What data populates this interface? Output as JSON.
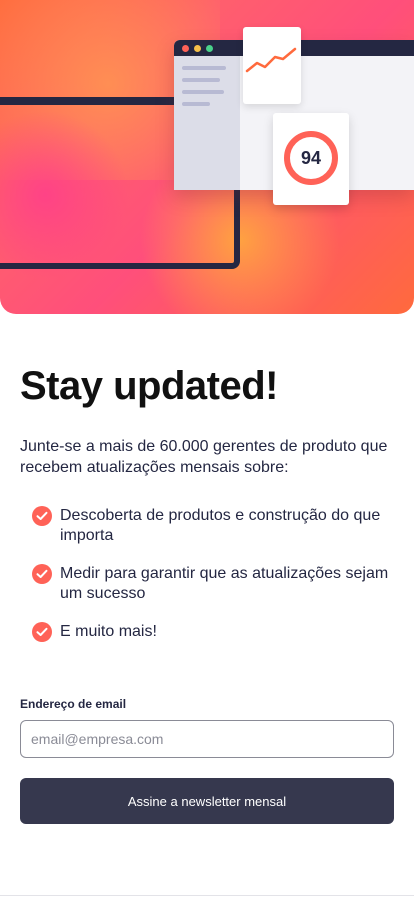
{
  "hero": {
    "score": "94",
    "colors": {
      "accent": "#ff6257",
      "navy": "#242742"
    }
  },
  "main": {
    "title": "Stay updated!",
    "intro": "Junte-se a mais de 60.000 gerentes de produto que recebem atualizações mensais sobre:",
    "features": [
      {
        "icon": "check-icon",
        "text": "Descoberta de produtos e construção do que importa"
      },
      {
        "icon": "check-icon",
        "text": "Medir para garantir que as atualizações sejam um sucesso"
      },
      {
        "icon": "check-icon",
        "text": "E muito mais!"
      }
    ]
  },
  "form": {
    "email_label": "Endereço de email",
    "email_placeholder": "email@empresa.com",
    "email_value": "",
    "submit_label": "Assine a newsletter mensal"
  },
  "colors": {
    "accent": "#ff6257",
    "button_bg": "#36384e",
    "text_dark": "#242742"
  }
}
